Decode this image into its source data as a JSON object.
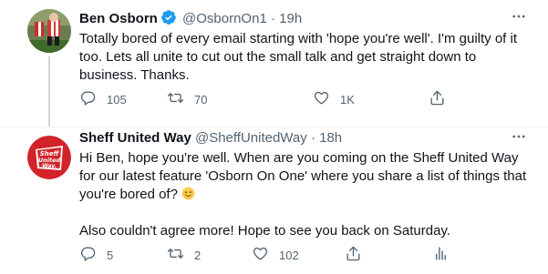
{
  "tweets": [
    {
      "author_name": "Ben Osborn",
      "handle": "@OsbornOn1",
      "separator": "·",
      "time": "19h",
      "text": "Totally bored of every email starting with 'hope you're well'. I'm guilty of it too. Lets all unite to cut out the small talk and get straight down to business. Thanks.",
      "replies": "105",
      "retweets": "70",
      "likes": "1K",
      "verified": true
    },
    {
      "author_name": "Sheff United Way",
      "handle": "@SheffUnitedWay",
      "separator": "·",
      "time": "18h",
      "text_main": "Hi Ben, hope you're well. When are you coming on the Sheff United Way for our latest feature 'Osborn On One' where you share a list of things that you're bored of? ",
      "text_after": "Also couldn't agree more! Hope to see you back on Saturday.",
      "replies": "5",
      "retweets": "2",
      "likes": "102",
      "avatar_text": "Sheff United Way"
    }
  ],
  "colors": {
    "text": "#0f1419",
    "secondary": "#536471",
    "verified_blue": "#1d9bf0",
    "brand_red": "#d2232a"
  }
}
